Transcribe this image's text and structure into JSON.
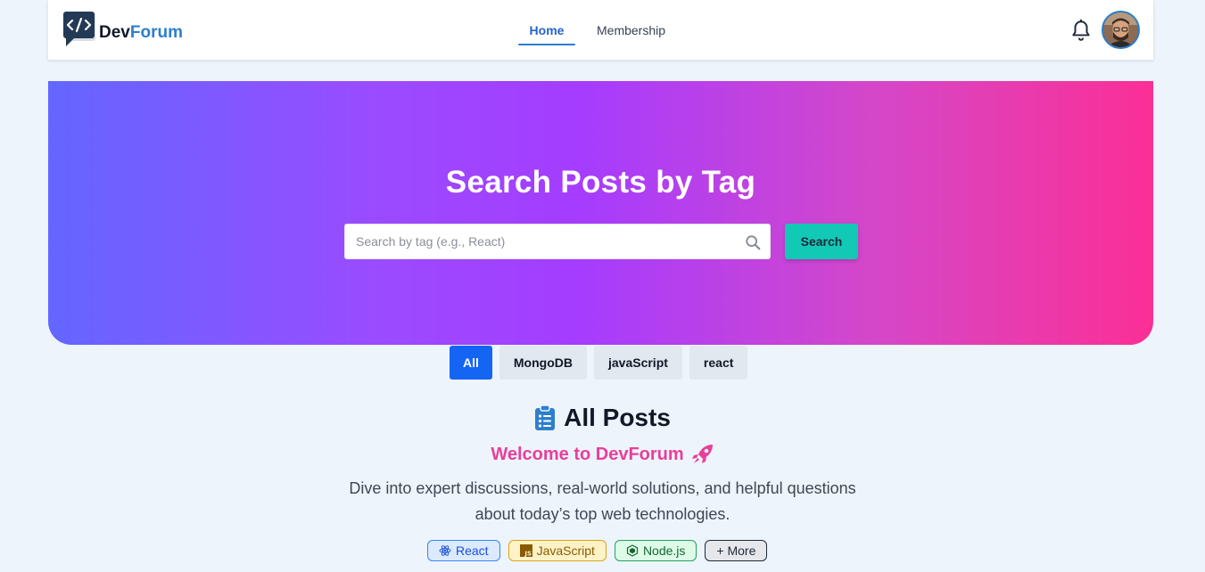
{
  "brand": {
    "name_part1": "Dev",
    "name_part2": "Forum"
  },
  "nav": {
    "items": [
      {
        "label": "Home",
        "active": true
      },
      {
        "label": "Membership",
        "active": false
      }
    ]
  },
  "hero": {
    "title": "Search Posts by Tag",
    "search_placeholder": "Search by tag (e.g., React)",
    "search_value": "",
    "search_button": "Search"
  },
  "filters": [
    {
      "label": "All",
      "active": true
    },
    {
      "label": "MongoDB",
      "active": false
    },
    {
      "label": "javaScript",
      "active": false
    },
    {
      "label": "react",
      "active": false
    }
  ],
  "posts_section": {
    "heading": "All Posts",
    "welcome": "Welcome to DevForum",
    "description_line1": "Dive into expert discussions, real-world solutions, and helpful questions",
    "description_line2": "about today’s top web technologies."
  },
  "tech_tags": [
    {
      "label": "React",
      "icon": "react-icon"
    },
    {
      "label": "JavaScript",
      "icon": "javascript-icon"
    },
    {
      "label": "Node.js",
      "icon": "nodejs-icon"
    },
    {
      "label": "+ More",
      "icon": ""
    }
  ],
  "colors": {
    "brand_blue": "#2d7fcb",
    "filter_active": "#1565f5",
    "search_button": "#12c9b5",
    "welcome_pink": "#e83e9c",
    "hero_gradient_start": "#6366ff",
    "hero_gradient_end": "#fb2f96"
  }
}
